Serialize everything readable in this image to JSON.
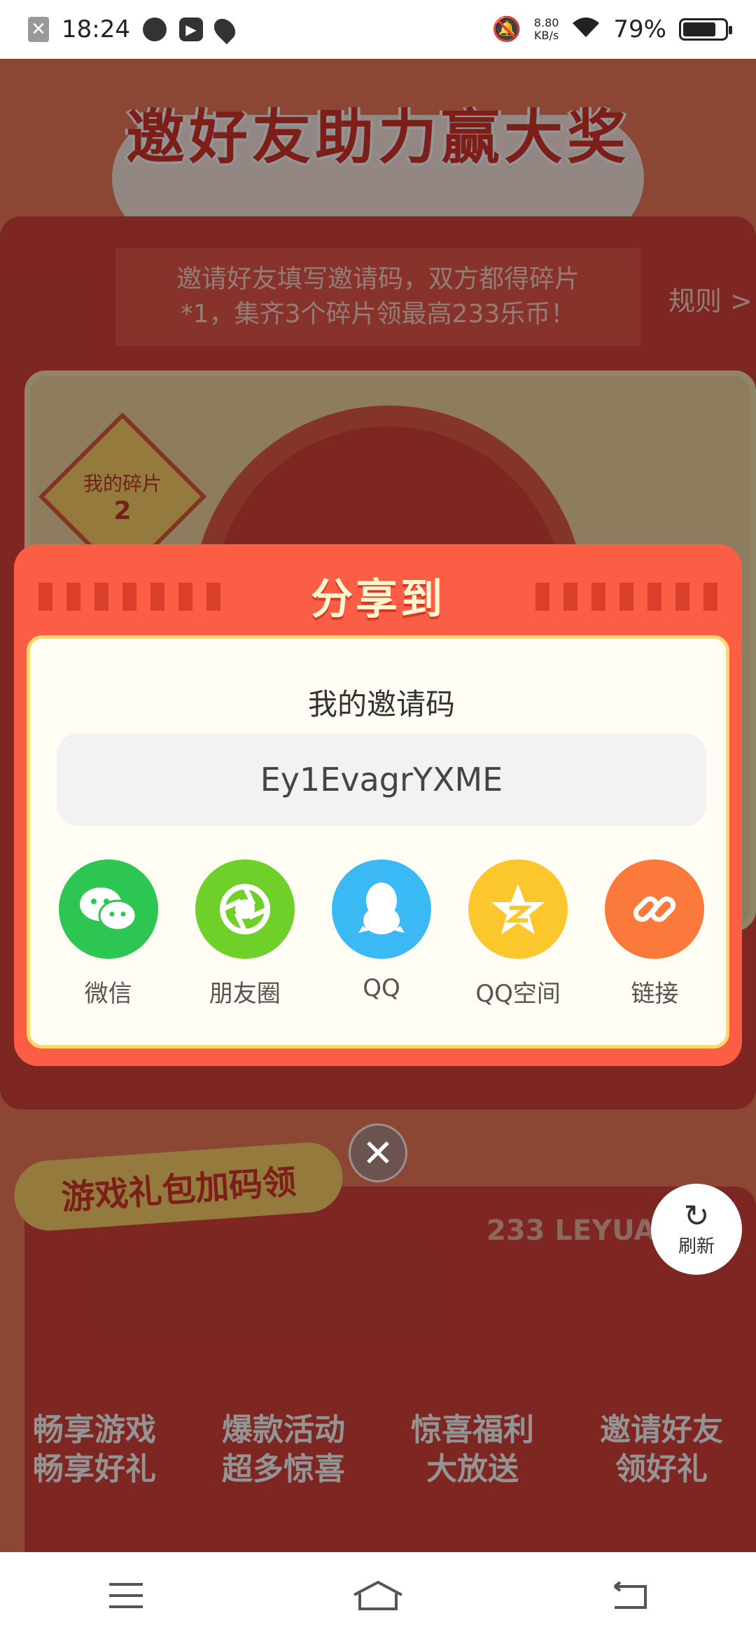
{
  "status_bar": {
    "time": "18:24",
    "net_speed": "8.80",
    "net_unit": "KB/s",
    "battery_text": "79%",
    "battery_level": 0.79
  },
  "background": {
    "banner_title": "邀好友助力赢大奖",
    "tip_line1": "邀请好友填写邀请码，双方都得碎片",
    "tip_line2": "*1，集齐3个碎片领最高233乐币！",
    "rules_link": "规则 >",
    "fragment_label": "我的碎片",
    "fragment_count": "2",
    "gift_tag": "游戏礼包加码领",
    "watermark": "233 LEYUAN",
    "promos": [
      {
        "line1": "畅享游戏",
        "line2": "畅享好礼"
      },
      {
        "line1": "爆款活动",
        "line2": "超多惊喜"
      },
      {
        "line1": "惊喜福利",
        "line2": "大放送"
      },
      {
        "line1": "邀请好友",
        "line2": "领好礼"
      }
    ],
    "refresh_label": "刷新"
  },
  "dialog": {
    "title": "分享到",
    "code_label": "我的邀请码",
    "code_value": "Ey1EvagrYXME",
    "share_targets": [
      {
        "label": "微信",
        "icon": "wechat-icon",
        "color": "#2dc653"
      },
      {
        "label": "朋友圈",
        "icon": "moments-icon",
        "color": "#6fd02a"
      },
      {
        "label": "QQ",
        "icon": "qq-icon",
        "color": "#3bb9f5"
      },
      {
        "label": "QQ空间",
        "icon": "qzone-icon",
        "color": "#fcc72c"
      },
      {
        "label": "链接",
        "icon": "link-icon",
        "color": "#fb7a3b"
      }
    ]
  },
  "colors": {
    "dialog_red": "#fb5d45",
    "page_red": "#d8433c"
  }
}
